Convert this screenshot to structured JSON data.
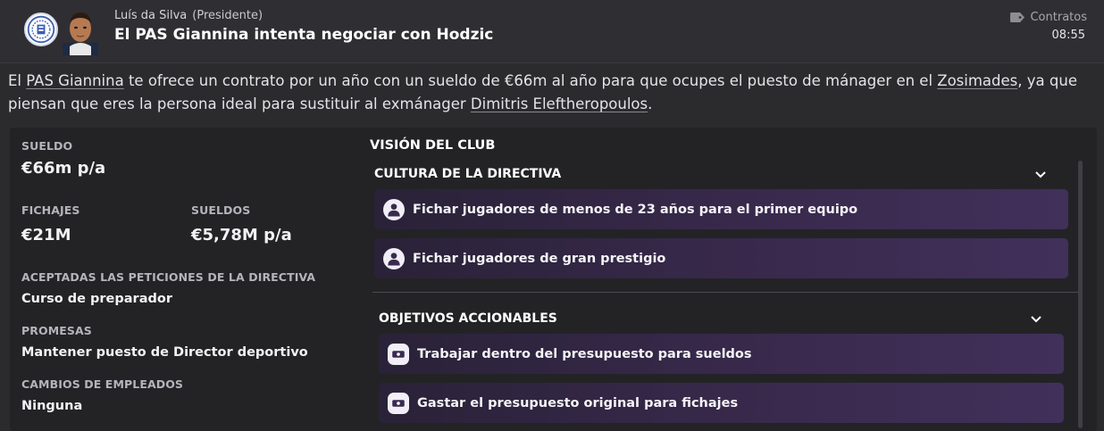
{
  "header": {
    "sender_name": "Luís da Silva",
    "sender_role": "(Presidente)",
    "subject": "El PAS Giannina intenta negociar con Hodzic",
    "category": "Contratos",
    "time": "08:55"
  },
  "message": {
    "parts": [
      {
        "text": "El ",
        "link": false
      },
      {
        "text": "PAS Giannina",
        "link": true
      },
      {
        "text": " te ofrece un contrato por un año con un sueldo de €66m al año para que ocupes el puesto de mánager en el ",
        "link": false
      },
      {
        "text": "Zosimades",
        "link": true
      },
      {
        "text": ", ya que piensan que eres la persona ideal para sustituir al exmánager ",
        "link": false
      },
      {
        "text": "Dimitris Eleftheropoulos",
        "link": true
      },
      {
        "text": ".",
        "link": false
      }
    ]
  },
  "contract": {
    "salary_label": "SUELDO",
    "salary_value": "€66m p/a",
    "transfers_label": "FICHAJES",
    "transfers_value": "€21M",
    "wages_label": "SUELDOS",
    "wages_value": "€5,78M p/a",
    "board_requests_label": "ACEPTADAS LAS PETICIONES DE LA DIRECTIVA",
    "board_requests_value": "Curso de preparador",
    "promises_label": "PROMESAS",
    "promises_value": "Mantener puesto de Director deportivo",
    "staff_changes_label": "CAMBIOS DE EMPLEADOS",
    "staff_changes_value": "Ninguna"
  },
  "vision": {
    "title": "VISIÓN DEL CLUB",
    "culture_title": "CULTURA DE LA DIRECTIVA",
    "culture_items": [
      {
        "label": "Fichar jugadores de menos de 23 años para el primer equipo",
        "icon": "person-icon"
      },
      {
        "label": "Fichar jugadores de gran prestigio",
        "icon": "person-icon"
      }
    ],
    "objectives_title": "OBJETIVOS ACCIONABLES",
    "objective_items": [
      {
        "label": "Trabajar dentro del presupuesto para sueldos",
        "icon": "money-icon"
      },
      {
        "label": "Gastar el presupuesto original para fichajes",
        "icon": "money-icon"
      }
    ]
  }
}
